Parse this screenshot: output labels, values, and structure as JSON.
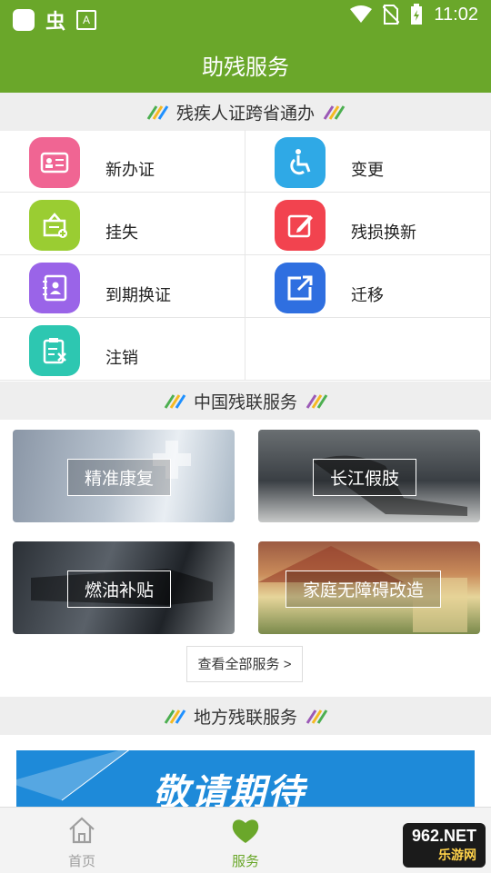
{
  "status_bar": {
    "time": "11:02",
    "left_glyph": "虫",
    "small_icon_letter": "A"
  },
  "header": {
    "title": "助残服务"
  },
  "sections": {
    "cross_province": "残疾人证跨省通办",
    "cdpf_services": "中国残联服务",
    "local_services": "地方残联服务"
  },
  "certificate_items": [
    {
      "label": "新办证",
      "icon": "id-card-icon",
      "color": "#f06593"
    },
    {
      "label": "变更",
      "icon": "wheelchair-icon",
      "color": "#2fa9e6"
    },
    {
      "label": "挂失",
      "icon": "report-loss-icon",
      "color": "#9acd32"
    },
    {
      "label": "残损换新",
      "icon": "edit-icon",
      "color": "#f2434f"
    },
    {
      "label": "到期换证",
      "icon": "contact-book-icon",
      "color": "#9a64e8"
    },
    {
      "label": "迁移",
      "icon": "move-out-icon",
      "color": "#2f6fe0"
    },
    {
      "label": "注销",
      "icon": "cancel-doc-icon",
      "color": "#2dc7b1"
    }
  ],
  "service_tiles": [
    {
      "label": "精准康复"
    },
    {
      "label": "长江假肢"
    },
    {
      "label": "燃油补贴"
    },
    {
      "label": "家庭无障碍改造"
    }
  ],
  "more_services": "查看全部服务 >",
  "banner": {
    "text": "敬请期待"
  },
  "bottom_nav": [
    {
      "label": "首页",
      "active": false
    },
    {
      "label": "服务",
      "active": true
    }
  ],
  "watermark": {
    "brand": "962.NET",
    "sub": "乐游网"
  },
  "colors": {
    "brand_green": "#6aa72a",
    "inactive_gray": "#9e9e9e",
    "section_bg": "#eeeeee"
  }
}
